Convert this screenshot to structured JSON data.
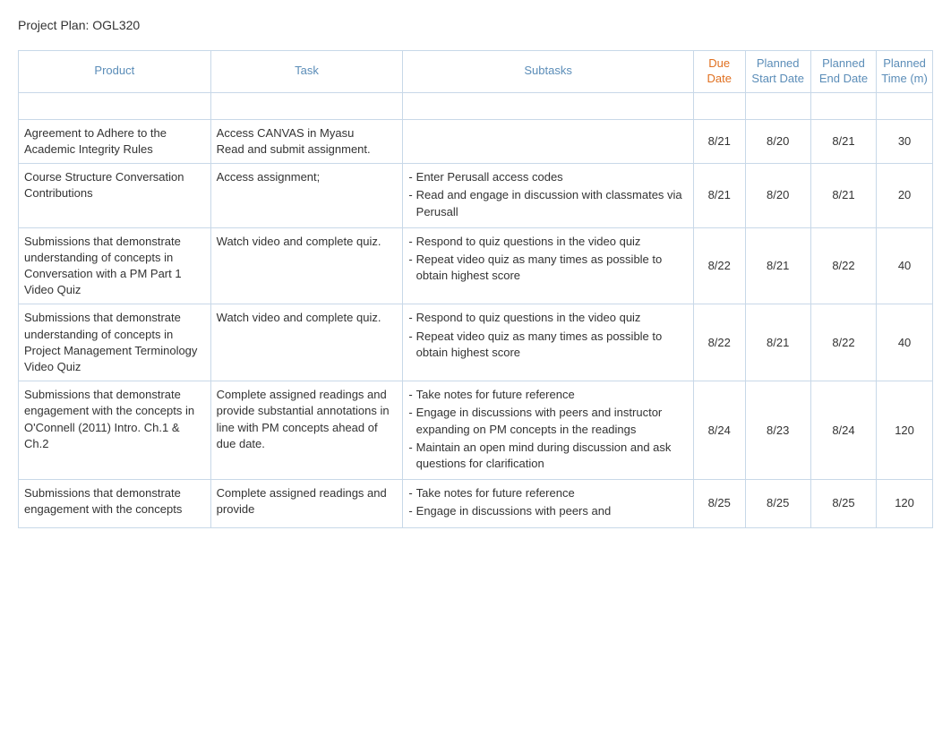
{
  "pageTitle": "Project Plan: OGL320",
  "columns": {
    "product": "Product",
    "task": "Task",
    "subtasks": "Subtasks",
    "dueDate": "Due Date",
    "plannedStartDate": "Planned Start Date",
    "plannedEndDate": "Planned End Date",
    "plannedTime": "Planned Time (m)"
  },
  "rows": [
    {
      "product": "",
      "task": "",
      "subtasks": [],
      "dueDate": "",
      "plannedStart": "",
      "plannedEnd": "",
      "plannedTime": ""
    },
    {
      "product": "Agreement to Adhere to the Academic Integrity Rules",
      "task": "Access CANVAS in Myasu\nRead and submit assignment.",
      "subtasks": [],
      "dueDate": "8/21",
      "plannedStart": "8/20",
      "plannedEnd": "8/21",
      "plannedTime": "30"
    },
    {
      "product": "Course Structure Conversation Contributions",
      "task": "Access assignment;",
      "subtasks": [
        "Enter Perusall access codes",
        "Read and engage in discussion with classmates via Perusall"
      ],
      "dueDate": "8/21",
      "plannedStart": "8/20",
      "plannedEnd": "8/21",
      "plannedTime": "20"
    },
    {
      "product": "Submissions that demonstrate understanding of concepts in Conversation with a PM Part 1 Video Quiz",
      "task": "Watch video and complete quiz.",
      "subtasks": [
        "Respond to quiz questions in the video quiz",
        "Repeat video quiz as many times as possible to obtain highest score"
      ],
      "dueDate": "8/22",
      "plannedStart": "8/21",
      "plannedEnd": "8/22",
      "plannedTime": "40"
    },
    {
      "product": "Submissions that demonstrate understanding of concepts in Project Management Terminology Video Quiz",
      "task": "Watch video and complete quiz.",
      "subtasks": [
        "Respond to quiz questions in the video quiz",
        "Repeat video quiz as many times as possible to obtain highest score"
      ],
      "dueDate": "8/22",
      "plannedStart": "8/21",
      "plannedEnd": "8/22",
      "plannedTime": "40"
    },
    {
      "product": "Submissions that demonstrate engagement with the concepts in O'Connell (2011) Intro. Ch.1 & Ch.2",
      "task": "Complete assigned readings and provide substantial annotations in line with PM concepts ahead of due date.",
      "subtasks": [
        "Take notes for future reference",
        "Engage in discussions with peers and instructor expanding on PM concepts in the readings",
        "Maintain an open mind during discussion and ask questions for clarification"
      ],
      "dueDate": "8/24",
      "plannedStart": "8/23",
      "plannedEnd": "8/24",
      "plannedTime": "120"
    },
    {
      "product": "Submissions that demonstrate engagement with the concepts",
      "task": "Complete assigned readings and provide",
      "subtasks": [
        "Take notes for future reference",
        "Engage in discussions with peers and"
      ],
      "dueDate": "8/25",
      "plannedStart": "8/25",
      "plannedEnd": "8/25",
      "plannedTime": "120"
    }
  ]
}
